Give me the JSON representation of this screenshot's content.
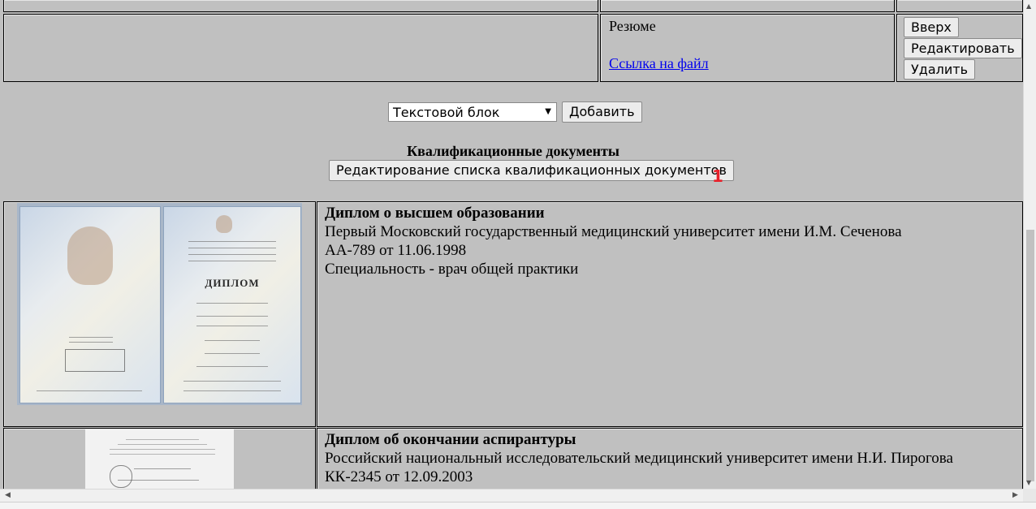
{
  "resume_row": {
    "title": "Резюме",
    "file_link": "Ссылка на файл",
    "actions": {
      "up": "Вверх",
      "edit": "Редактировать",
      "delete": "Удалить"
    }
  },
  "add_block": {
    "select_value": "Текстовой блок",
    "add_button": "Добавить"
  },
  "qualifications": {
    "title": "Квалификационные документы",
    "edit_list_button": "Редактирование списка квалификационных документов",
    "marker": "1",
    "documents": [
      {
        "title": "Диплом о высшем образовании",
        "institution": "Первый Московский государственный медицинский университет имени И.М. Сеченова",
        "number": "АА-789 от 11.06.1998",
        "specialty": "Специальность - врач общей практики",
        "image_caption": "ДИПЛОМ",
        "image": "diploma-image"
      },
      {
        "title": "Диплом об окончании аспирантуры",
        "institution": "Российский национальный исследовательский медицинский университет имени Н.И. Пирогова",
        "number": "КК-2345 от 12.09.2003",
        "image": "diploma-image"
      }
    ]
  },
  "scrollbars": {
    "vertical": {
      "up_icon": "arrow-up-icon",
      "down_icon": "arrow-down-icon"
    },
    "horizontal": {
      "left_icon": "arrow-left-icon",
      "right_icon": "arrow-right-icon"
    }
  }
}
